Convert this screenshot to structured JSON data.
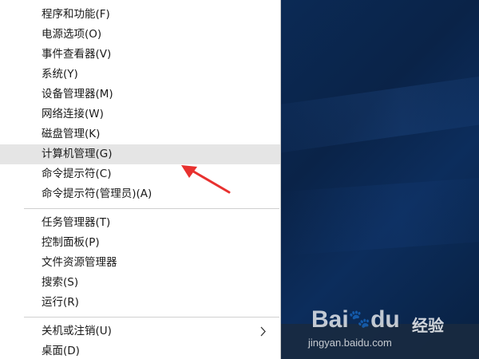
{
  "menu": {
    "groups": [
      [
        {
          "label": "程序和功能(F)"
        },
        {
          "label": "电源选项(O)"
        },
        {
          "label": "事件查看器(V)"
        },
        {
          "label": "系统(Y)"
        },
        {
          "label": "设备管理器(M)"
        },
        {
          "label": "网络连接(W)"
        },
        {
          "label": "磁盘管理(K)"
        },
        {
          "label": "计算机管理(G)",
          "highlighted": true
        },
        {
          "label": "命令提示符(C)"
        },
        {
          "label": "命令提示符(管理员)(A)"
        }
      ],
      [
        {
          "label": "任务管理器(T)"
        },
        {
          "label": "控制面板(P)"
        },
        {
          "label": "文件资源管理器"
        },
        {
          "label": "搜索(S)"
        },
        {
          "label": "运行(R)"
        }
      ],
      [
        {
          "label": "关机或注销(U)",
          "submenu": true
        },
        {
          "label": "桌面(D)"
        }
      ]
    ]
  },
  "icons": {
    "submenu": "chevron-right-icon"
  },
  "watermark": {
    "logo": "Bai",
    "logo2": "du",
    "label": "经验",
    "url": "jingyan.baidu.com"
  },
  "colors": {
    "highlight": "#e5e5e5",
    "arrow": "#e8312f",
    "desktop": "#0b2a55"
  }
}
